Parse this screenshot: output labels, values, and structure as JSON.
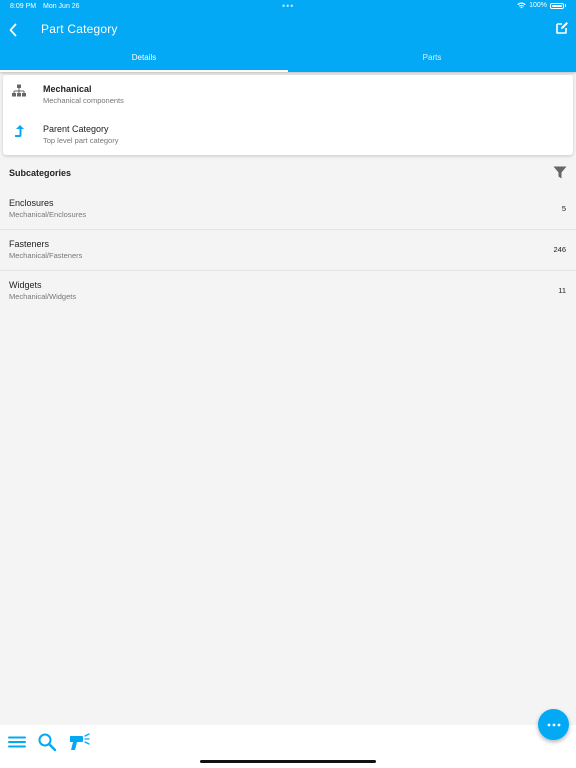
{
  "status_bar": {
    "time": "8:09 PM",
    "date": "Mon Jun 26",
    "battery": "100%",
    "dots": "•••"
  },
  "header": {
    "title": "Part Category",
    "background_color": "#03a9f4"
  },
  "tabs": [
    {
      "label": "Details",
      "active": true
    },
    {
      "label": "Parts",
      "active": false
    }
  ],
  "details": {
    "category": {
      "name": "Mechanical",
      "description": "Mechanical components",
      "icon": "sitemap-icon"
    },
    "parent": {
      "label": "Parent Category",
      "description": "Top level part category",
      "icon": "level-up-icon"
    }
  },
  "subcategories": {
    "heading": "Subcategories",
    "items": [
      {
        "name": "Enclosures",
        "path": "Mechanical/Enclosures",
        "count": "5"
      },
      {
        "name": "Fasteners",
        "path": "Mechanical/Fasteners",
        "count": "246"
      },
      {
        "name": "Widgets",
        "path": "Mechanical/Widgets",
        "count": "11"
      }
    ]
  },
  "bottom_nav": {
    "items": [
      "menu-icon",
      "search-icon",
      "barcode-scanner-icon"
    ]
  },
  "fab": {
    "icon": "more-horizontal-icon"
  },
  "accent_color": "#03a9f4"
}
